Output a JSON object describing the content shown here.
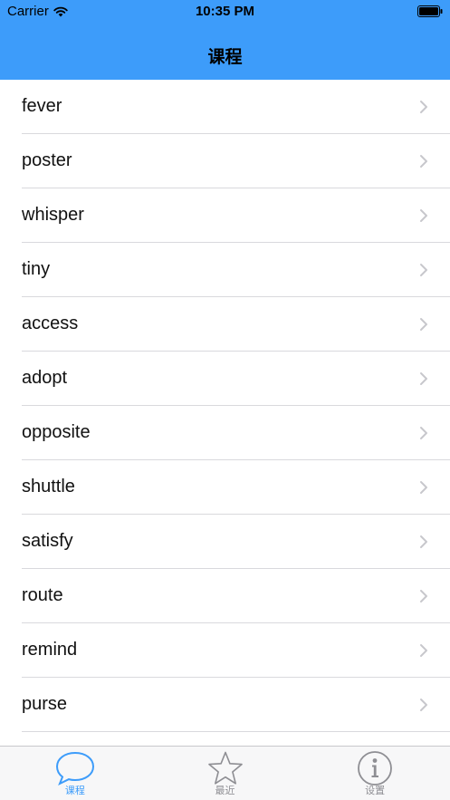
{
  "status_bar": {
    "carrier": "Carrier",
    "time": "10:35 PM"
  },
  "nav": {
    "title": "课程"
  },
  "list": {
    "items": [
      {
        "label": "fever"
      },
      {
        "label": "poster"
      },
      {
        "label": "whisper"
      },
      {
        "label": "tiny"
      },
      {
        "label": "access"
      },
      {
        "label": "adopt"
      },
      {
        "label": "opposite"
      },
      {
        "label": "shuttle"
      },
      {
        "label": "satisfy"
      },
      {
        "label": "route"
      },
      {
        "label": "remind"
      },
      {
        "label": "purse"
      }
    ]
  },
  "tab_bar": {
    "tabs": [
      {
        "label": "课程",
        "icon": "chat-bubble-icon",
        "active": true
      },
      {
        "label": "最近",
        "icon": "star-icon",
        "active": false
      },
      {
        "label": "设置",
        "icon": "info-icon",
        "active": false
      }
    ]
  },
  "colors": {
    "accent": "#3d9cfa",
    "chevron": "#c7c7cc",
    "inactive_tab": "#8e8e93"
  }
}
